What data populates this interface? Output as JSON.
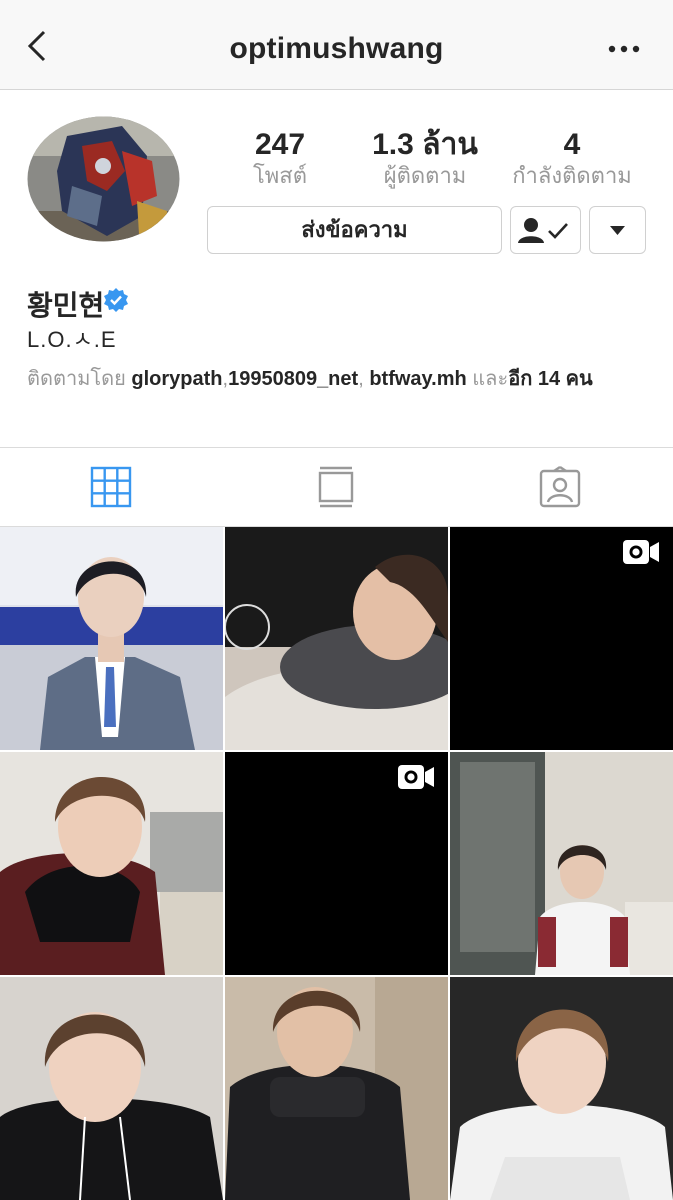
{
  "header": {
    "username": "optimushwang",
    "back_icon": "chevron-left-icon",
    "more_icon": "more-dots-icon"
  },
  "profile": {
    "stats": [
      {
        "value": "247",
        "label": "โพสต์"
      },
      {
        "value": "1.3 ล้าน",
        "label": "ผู้ติดตาม"
      },
      {
        "value": "4",
        "label": "กำลังติดตาม"
      }
    ],
    "message_button": "ส่งข้อความ",
    "name": "황민현",
    "bio": "L.O.ㅅ.E",
    "followed_by": {
      "prefix": "ติดตามโดย ",
      "user1": "glorypath",
      "sep1": ",",
      "user2": "19950809_net",
      "sep2": ", ",
      "user3": "btfway.mh",
      "middle": " และ",
      "more": "อีก 14 คน"
    }
  },
  "tabs": [
    {
      "icon": "grid-icon",
      "active": true
    },
    {
      "icon": "feed-icon",
      "active": false
    },
    {
      "icon": "tagged-icon",
      "active": false
    }
  ],
  "posts": [
    {
      "kind": "photo"
    },
    {
      "kind": "photo"
    },
    {
      "kind": "video"
    },
    {
      "kind": "photo"
    },
    {
      "kind": "video"
    },
    {
      "kind": "photo"
    },
    {
      "kind": "photo"
    },
    {
      "kind": "photo"
    },
    {
      "kind": "photo"
    }
  ],
  "colors": {
    "active_tab": "#3897f0",
    "verified": "#3897f0",
    "muted_text": "#999999"
  }
}
